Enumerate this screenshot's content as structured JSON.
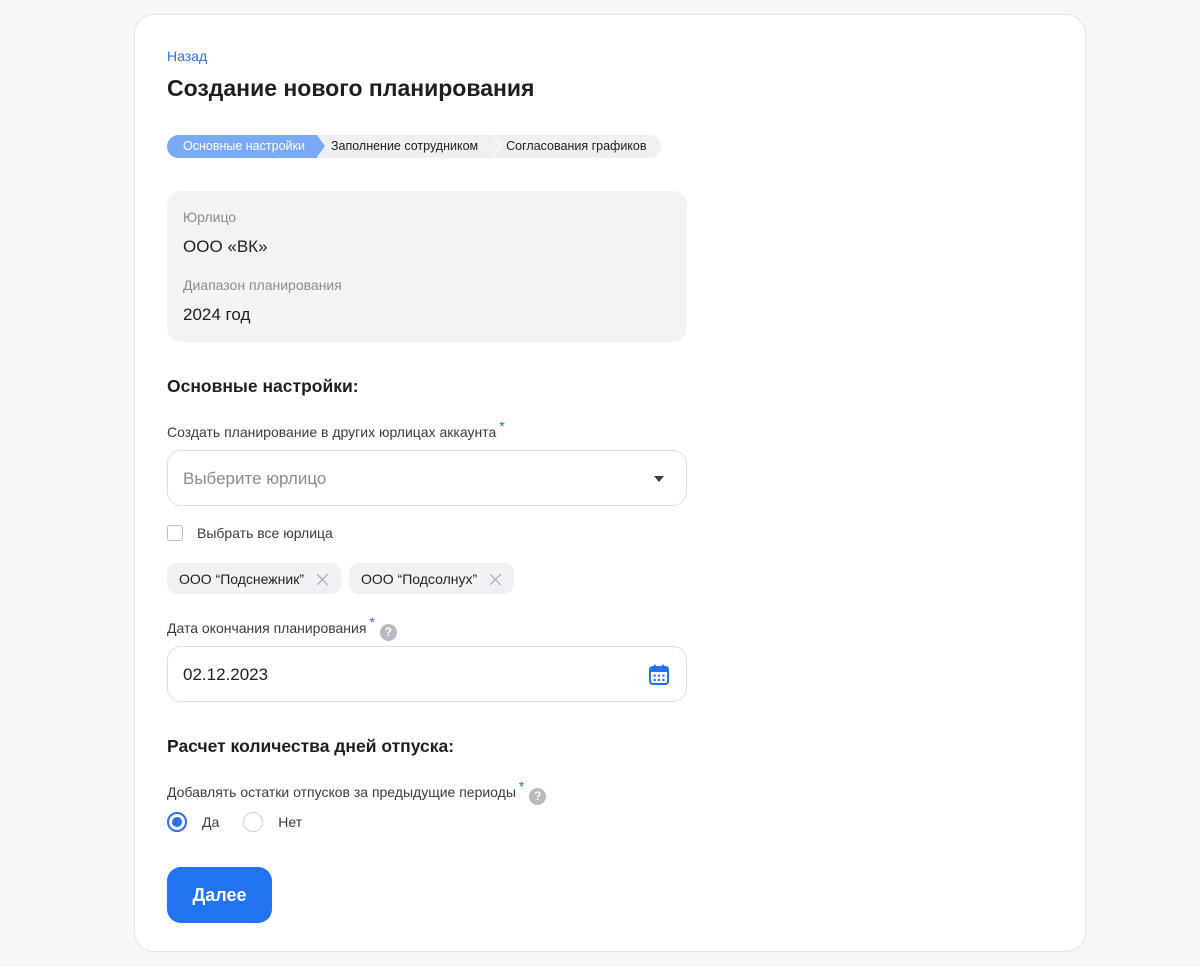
{
  "nav": {
    "back_label": "Назад"
  },
  "page": {
    "title": "Создание нового планирования"
  },
  "stepper": {
    "steps": [
      {
        "label": "Основные настройки",
        "active": true
      },
      {
        "label": "Заполнение сотрудником",
        "active": false
      },
      {
        "label": "Согласования графиков",
        "active": false
      }
    ],
    "active_color": "#7aaaf6"
  },
  "info": {
    "entity_label": "Юрлицо",
    "entity_value": "ООО «ВК»",
    "range_label": "Диапазон планирования",
    "range_value": "2024 год"
  },
  "main_settings": {
    "title": "Основные настройки:",
    "entities_field": {
      "label": "Создать планирование в других юрлицах аккаунта",
      "required_mark": "*",
      "placeholder": "Выберите юрлицо"
    },
    "select_all": {
      "label": "Выбрать все юрлица",
      "checked": false
    },
    "selected_entities": [
      "ООО “Подснежник”",
      "ООО “Подсолнух”"
    ],
    "end_date_field": {
      "label": "Дата окончания планирования",
      "required_mark": "*",
      "help_icon": "?",
      "value": "02.12.2023"
    }
  },
  "vacation_calc": {
    "title": "Расчет количества дней отпуска:",
    "carryover_field": {
      "label": "Добавлять остатки отпусков за предыдущие периоды",
      "required_mark": "*",
      "help_icon": "?",
      "options": [
        {
          "label": "Да",
          "checked": true
        },
        {
          "label": "Нет",
          "checked": false
        }
      ]
    }
  },
  "actions": {
    "next_label": "Далее"
  },
  "colors": {
    "accent": "#2173f2",
    "link": "#2a6fe8"
  }
}
